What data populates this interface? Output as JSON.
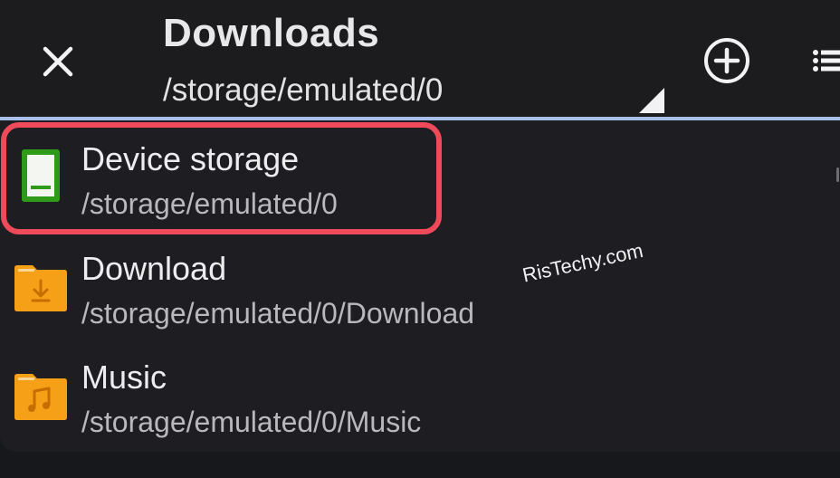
{
  "header": {
    "title": "Downloads",
    "current_path": "/storage/emulated/0"
  },
  "icons": {
    "close": "close-icon",
    "add": "add-circle-icon",
    "list_view": "list-view-icon",
    "dropdown": "dropdown-triangle-icon"
  },
  "items": [
    {
      "name": "Device storage",
      "path": "/storage/emulated/0",
      "icon": "device-storage-icon",
      "highlighted": true
    },
    {
      "name": "Download",
      "path": "/storage/emulated/0/Download",
      "icon": "download-folder-icon",
      "highlighted": false
    },
    {
      "name": "Music",
      "path": "/storage/emulated/0/Music",
      "icon": "music-folder-icon",
      "highlighted": false
    }
  ],
  "watermark": "RisTechy.com",
  "colors": {
    "background": "#17181b",
    "accent_line": "#a9c0ea",
    "highlight_border": "#ef4a5a",
    "storage_green": "#2e9a18",
    "folder_orange": "#f5a017"
  }
}
